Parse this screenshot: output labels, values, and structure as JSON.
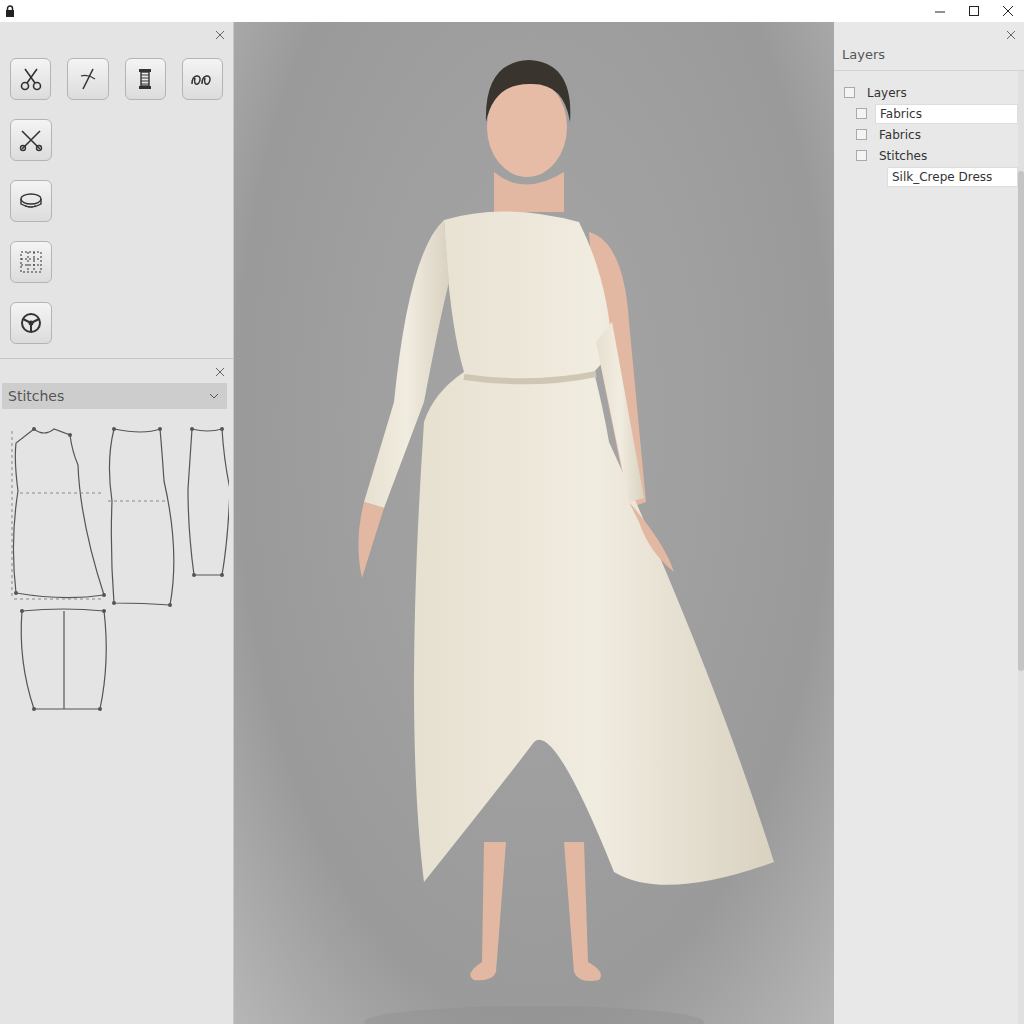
{
  "stitches_panel": {
    "dropdown": {
      "value": "Stitches"
    }
  },
  "layers_panel": {
    "title": "Layers",
    "tree": [
      {
        "label": "Layers",
        "kind": "checkbox",
        "checked": false,
        "selected": false,
        "children": [
          {
            "label": "Fabrics",
            "kind": "checkbox",
            "checked": false,
            "selected": true,
            "children": []
          },
          {
            "label": "Fabrics",
            "kind": "checkbox",
            "checked": false,
            "selected": false,
            "children": []
          },
          {
            "label": "Stitches",
            "kind": "checkbox",
            "checked": false,
            "selected": false,
            "children": [
              {
                "label": "Silk_Crepe Dress",
                "kind": "label",
                "checked": false,
                "selected": true,
                "children": []
              }
            ]
          }
        ]
      }
    ]
  }
}
